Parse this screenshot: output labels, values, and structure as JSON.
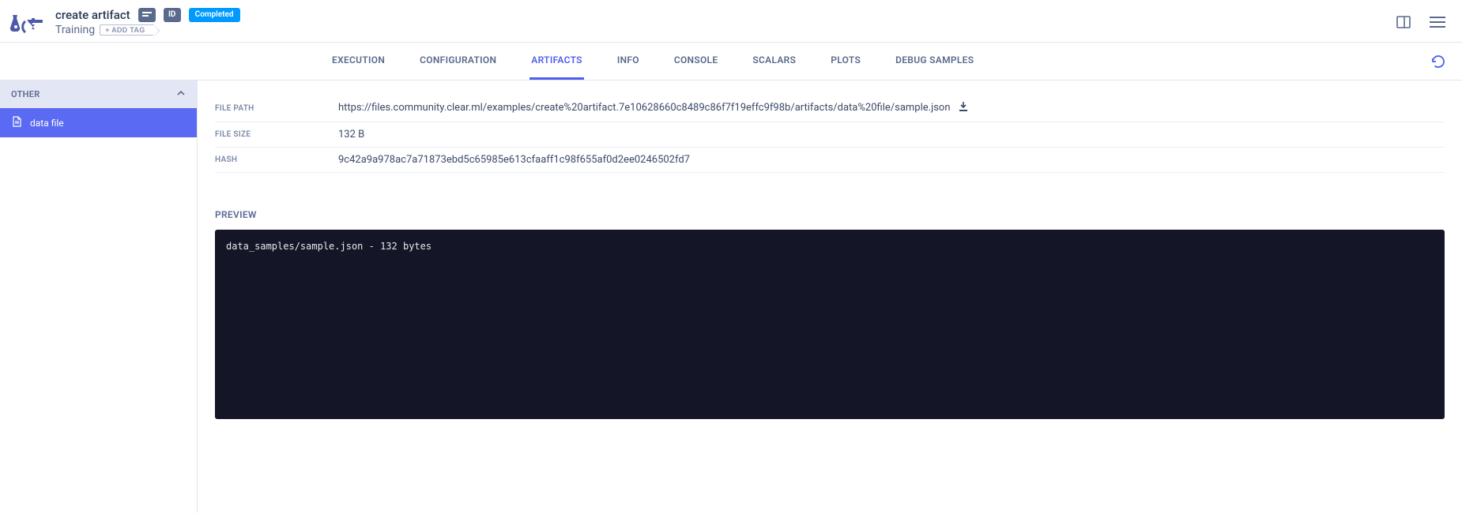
{
  "header": {
    "title": "create artifact",
    "subtitle": "Training",
    "add_tag_label": "+ ADD TAG",
    "status_label": "Completed",
    "id_label": "ID"
  },
  "tabs": {
    "items": [
      {
        "label": "EXECUTION"
      },
      {
        "label": "CONFIGURATION"
      },
      {
        "label": "ARTIFACTS"
      },
      {
        "label": "INFO"
      },
      {
        "label": "CONSOLE"
      },
      {
        "label": "SCALARS"
      },
      {
        "label": "PLOTS"
      },
      {
        "label": "DEBUG SAMPLES"
      }
    ],
    "active_index": 2
  },
  "sidebar": {
    "section_label": "OTHER",
    "items": [
      {
        "label": "data file"
      }
    ],
    "active_index": 0
  },
  "details": {
    "file_path_label": "FILE PATH",
    "file_path_value": "https://files.community.clear.ml/examples/create%20artifact.7e10628660c8489c86f7f19effc9f98b/artifacts/data%20file/sample.json",
    "file_size_label": "FILE SIZE",
    "file_size_value": "132 B",
    "hash_label": "HASH",
    "hash_value": "9c42a9a978ac7a71873ebd5c65985e613cfaaff1c98f655af0d2ee0246502fd7",
    "preview_label": "PREVIEW",
    "preview_text": "data_samples/sample.json - 132 bytes"
  }
}
